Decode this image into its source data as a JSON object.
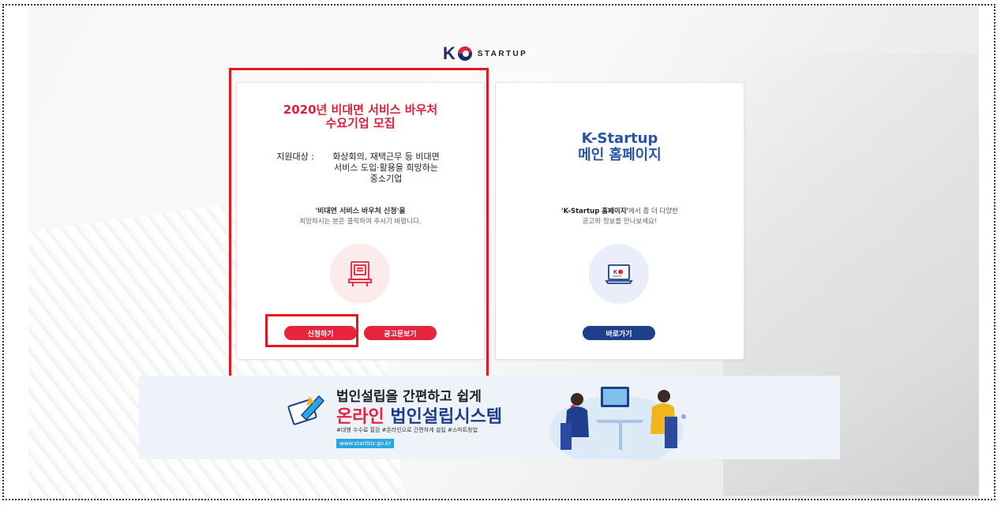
{
  "logo": {
    "letter": "K",
    "word": "STARTUP"
  },
  "left_card": {
    "title_line1": "2020년 비대면 서비스 바우처",
    "title_line2": "수요기업 모집",
    "target_label": "지원대상 :",
    "target_line1": "화상회의, 재택근무 등 비대면",
    "target_line2": "서비스 도입·활용을 희망하는",
    "target_line3": "중소기업",
    "note_line1": "'비대면 서비스 바우처 신청'을",
    "note_line2": "희망하시는 분은 클릭하여 주시기 바랍니다.",
    "apply_button": "신청하기",
    "notice_button": "공고문보기"
  },
  "right_card": {
    "title_line1": "K-Startup",
    "title_line2": "메인 홈페이지",
    "note_bold": "'K-Startup 홈페이지'",
    "note_rest": "에서 좀 더 다양한",
    "note_line2": "공고와 정보를 만나보세요!",
    "go_button": "바로가기",
    "screen_logo": "K",
    "screen_word": "STARTUP"
  },
  "banner": {
    "headline": "법인설립을 간편하고 쉽게",
    "title_red": "온라인",
    "title_blue": " 법인설립시스템",
    "tags": "#대행 수수료 절감 #온라인으로 간편하게 설립 #스마트창업",
    "url": "www.startbiz.go.kr"
  },
  "colors": {
    "red": "#e6243d",
    "blue": "#1f3e8c",
    "highlight": "#e8141e"
  }
}
